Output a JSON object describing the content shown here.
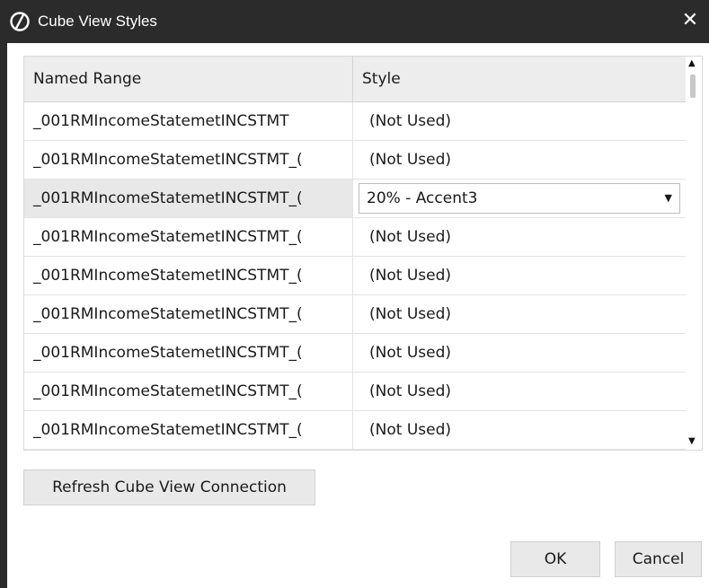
{
  "window": {
    "title": "Cube View Styles",
    "close_label": "✕"
  },
  "grid": {
    "columns": [
      "Named Range",
      "Style"
    ],
    "rows": [
      {
        "named_range": "_001RMIncomeStatemetINCSTMT",
        "style": "(Not Used)"
      },
      {
        "named_range": "_001RMIncomeStatemetINCSTMT_(",
        "style": "(Not Used)"
      },
      {
        "named_range": "_001RMIncomeStatemetINCSTMT_(",
        "style": "20% - Accent3",
        "editing": true
      },
      {
        "named_range": "_001RMIncomeStatemetINCSTMT_(",
        "style": "(Not Used)"
      },
      {
        "named_range": "_001RMIncomeStatemetINCSTMT_(",
        "style": "(Not Used)"
      },
      {
        "named_range": "_001RMIncomeStatemetINCSTMT_(",
        "style": "(Not Used)"
      },
      {
        "named_range": "_001RMIncomeStatemetINCSTMT_(",
        "style": "(Not Used)"
      },
      {
        "named_range": "_001RMIncomeStatemetINCSTMT_(",
        "style": "(Not Used)"
      },
      {
        "named_range": "_001RMIncomeStatemetINCSTMT_(",
        "style": "(Not Used)"
      }
    ]
  },
  "buttons": {
    "refresh": "Refresh Cube View Connection",
    "ok": "OK",
    "cancel": "Cancel"
  },
  "icons": {
    "logo": "onestream-logo-icon",
    "dropdown": "dropdown-arrow-icon",
    "scroll_up": "scroll-up-icon",
    "scroll_down": "scroll-down-icon"
  }
}
